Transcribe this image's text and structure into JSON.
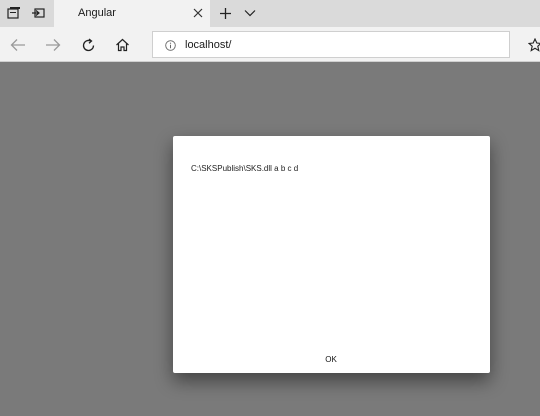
{
  "browser": {
    "tab": {
      "title": "Angular",
      "close_icon": "close-icon"
    },
    "address_bar": {
      "url": "localhost/"
    }
  },
  "dialog": {
    "message": "C:\\SKSPublish\\SKS.dll a b c d",
    "ok_label": "OK"
  },
  "colors": {
    "overlay": "#7a7a7a",
    "tab_strip": "#dadada",
    "toolbar": "#f2f2f2",
    "dialog_bg": "#ffffff"
  }
}
